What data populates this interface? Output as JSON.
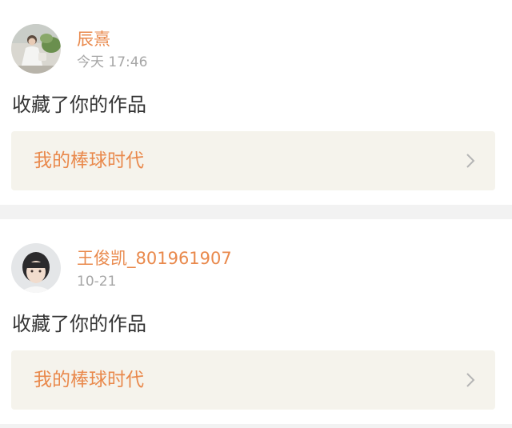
{
  "notifications": [
    {
      "avatar": "user-avatar-photo",
      "username": "辰熹",
      "time": "今天 17:46",
      "action": "收藏了你的作品",
      "work_title": "我的棒球时代",
      "chevron": "chevron-right-icon"
    },
    {
      "avatar": "user-avatar-photo",
      "username": "王俊凯_801961907",
      "time": "10-21",
      "action": "收藏了你的作品",
      "work_title": "我的棒球时代",
      "chevron": "chevron-right-icon"
    }
  ],
  "colors": {
    "username": "#e9894c",
    "time": "#a6a6a6",
    "action": "#333333",
    "work_box": "#f5f3ec",
    "background": "#f2f2f2"
  }
}
